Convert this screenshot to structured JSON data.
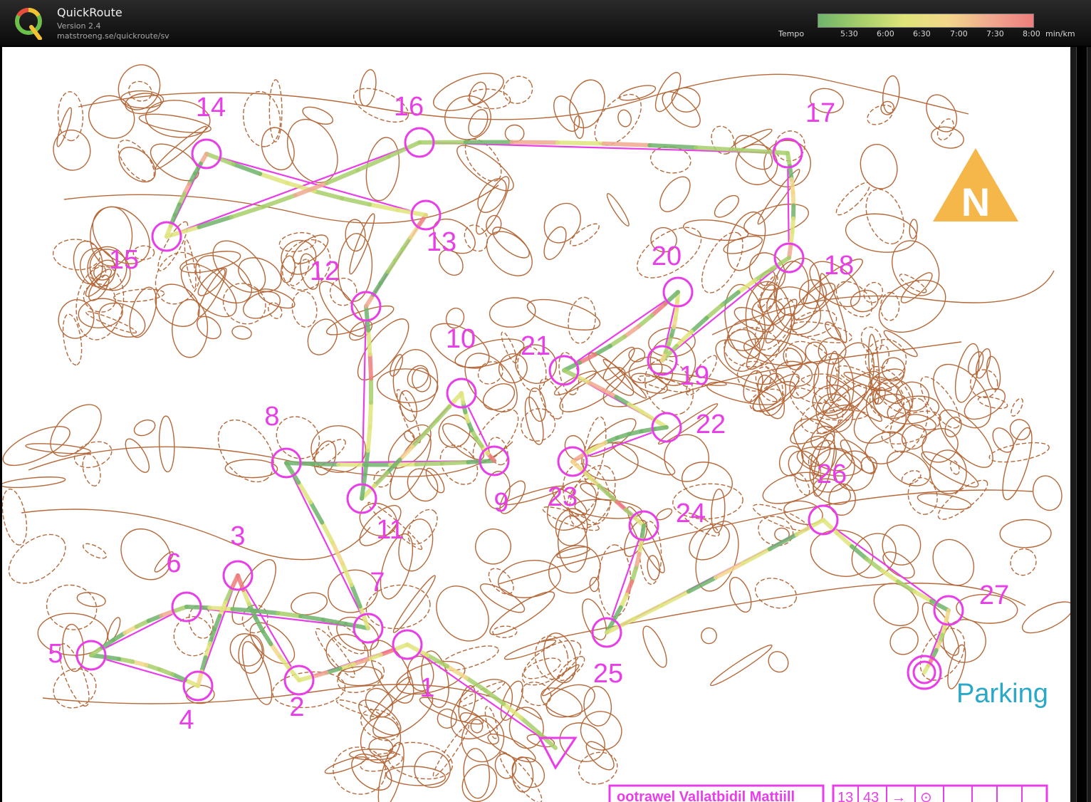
{
  "app": {
    "name": "QuickRoute",
    "version": "Version 2.4",
    "url": "matstroeng.se/quickroute/sv"
  },
  "legend": {
    "label": "Tempo",
    "ticks": [
      "5:30",
      "6:00",
      "6:30",
      "7:00",
      "7:30",
      "8:00"
    ],
    "unit": "min/km",
    "colors": [
      "#6fb46b",
      "#a7cf6a",
      "#dfe47a",
      "#f2d78a",
      "#f0a98f",
      "#ee7d7d"
    ]
  },
  "map": {
    "controls": [
      "1",
      "2",
      "3",
      "4",
      "5",
      "6",
      "7",
      "8",
      "9",
      "10",
      "11",
      "12",
      "13",
      "14",
      "15",
      "16",
      "17",
      "18",
      "19",
      "20",
      "21",
      "22",
      "23",
      "24",
      "25",
      "26",
      "27"
    ],
    "finish_label": "Parking",
    "north_label": "N",
    "title_box_text": "ootrawel Vallatbidil Mattiill",
    "description_cells": [
      "13",
      "43",
      "→",
      "⊙"
    ],
    "colors": {
      "course": "#e83ee8",
      "contours": "#b5693a",
      "parking": "#2aa8c8",
      "north": "#f5b64a"
    }
  }
}
